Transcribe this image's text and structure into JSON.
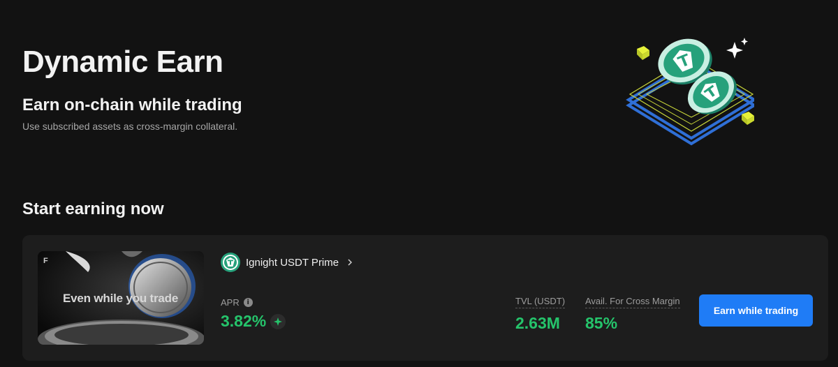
{
  "hero": {
    "title": "Dynamic Earn",
    "subtitle": "Earn on-chain while trading",
    "description": "Use subscribed assets as cross-margin collateral."
  },
  "section": {
    "title": "Start earning now"
  },
  "card": {
    "image_text": "Even while you trade",
    "product_name": "Ignight USDT Prime",
    "apr_label": "APR",
    "apr_value": "3.82%",
    "tvl_label": "TVL (USDT)",
    "tvl_value": "2.63M",
    "margin_label": "Avail. For Cross Margin",
    "margin_value": "85%",
    "cta_label": "Earn while trading"
  },
  "colors": {
    "background": "#121212",
    "card": "#1d1d1d",
    "accent_blue": "#1f7cf6",
    "positive_green": "#25c46b",
    "tether_teal": "#26a17b"
  },
  "icons": [
    "tether-coin-icon",
    "chevron-right-icon",
    "info-icon",
    "sparkle-boost-icon"
  ]
}
